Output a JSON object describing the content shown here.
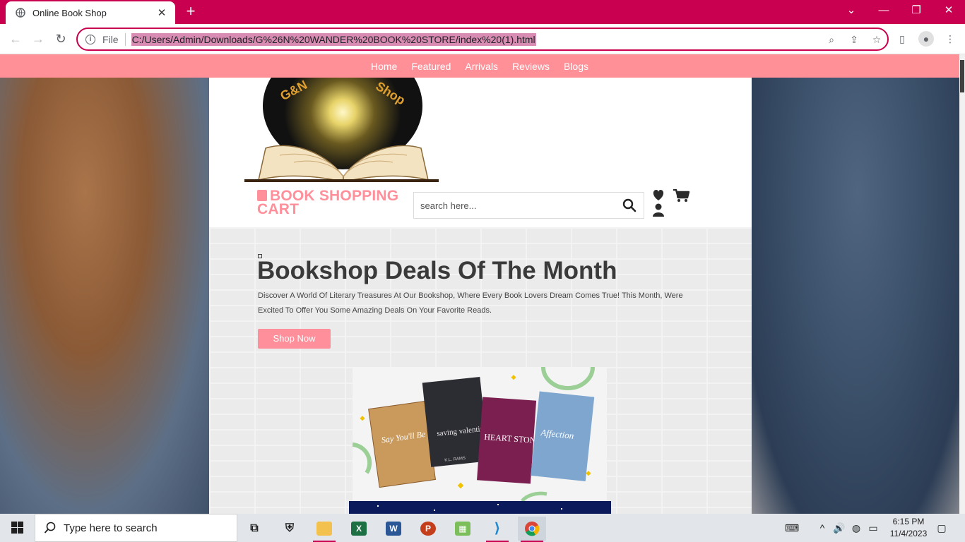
{
  "browser": {
    "tab_title": "Online Book Shop",
    "new_tab_glyph": "+",
    "close_glyph": "✕",
    "file_label": "File",
    "url": "C:/Users/Admin/Downloads/G%26N%20WANDER%20BOOK%20STORE/index%20(1).html",
    "icons": [
      "back-arrow-icon",
      "forward-arrow-icon",
      "reload-icon",
      "info-icon",
      "zoom-icon",
      "share-icon",
      "star-icon",
      "sidebar-icon",
      "profile-icon",
      "kebab-menu-icon"
    ],
    "accent": "#c8004f"
  },
  "site": {
    "nav": [
      "Home",
      "Featured",
      "Arrivals",
      "Reviews",
      "Blogs"
    ],
    "logo_text_left": "G&N",
    "logo_text_right": "Shop",
    "brand": "BOOK SHOPPING CART",
    "search_placeholder": "search here...",
    "hero": {
      "title": "Bookshop Deals Of The Month",
      "description": "Discover A World Of Literary Treasures At Our Bookshop, Where Every Book Lovers Dream Comes True! This Month, Were Excited To Offer You Some Amazing Deals On Your Favorite Reads.",
      "button": "Shop Now"
    },
    "promo_books": [
      "Say You'll Be Mine",
      "saving valentine",
      "HEART STONE",
      "Affection"
    ],
    "promo_author": "K.L. RAMS",
    "colors": {
      "nav_bg": "#ff9098",
      "brand": "#ff8f9a",
      "title": "#3a3a3a"
    }
  },
  "taskbar": {
    "search_text": "Type here to search",
    "time": "6:15 PM",
    "date": "11/4/2023",
    "apps": [
      "task-view",
      "security",
      "file-explorer",
      "excel",
      "word",
      "powerpoint",
      "calculator",
      "vscode",
      "chrome"
    ]
  }
}
